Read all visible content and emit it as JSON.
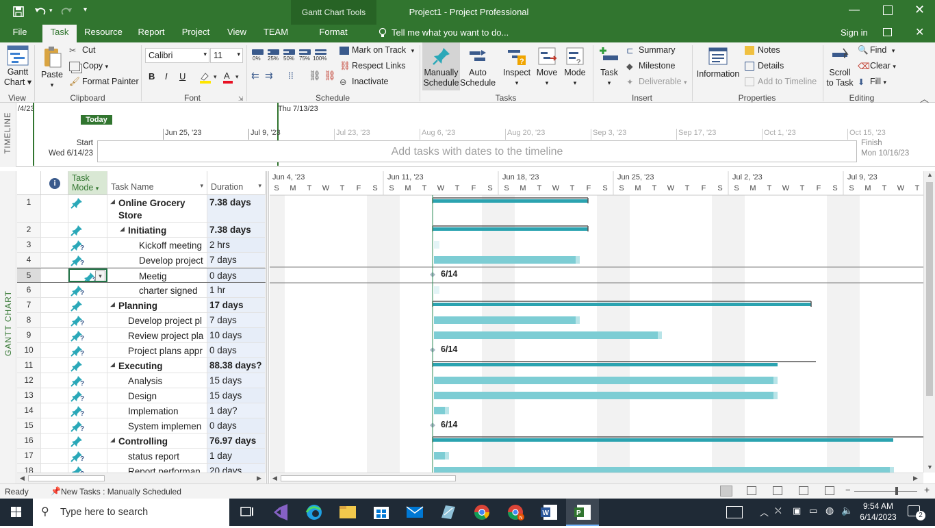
{
  "window": {
    "contextual_tab_group": "Gantt Chart Tools",
    "title": "Project1 - Project Professional",
    "qat_labels": [
      "save",
      "undo",
      "redo",
      "customize"
    ]
  },
  "tabs": {
    "file": "File",
    "task": "Task",
    "resource": "Resource",
    "report": "Report",
    "project": "Project",
    "view": "View",
    "team": "TEAM",
    "format": "Format",
    "tell_me": "Tell me what you want to do...",
    "sign_in": "Sign in"
  },
  "ribbon": {
    "view_group": {
      "gantt_line1": "Gantt",
      "gantt_line2": "Chart",
      "label": "View"
    },
    "clipboard": {
      "paste": "Paste",
      "cut": "Cut",
      "copy": "Copy",
      "format_painter": "Format Painter",
      "label": "Clipboard"
    },
    "font": {
      "font_name": "Calibri",
      "font_size": "11",
      "bold": "B",
      "italic": "I",
      "underline": "U",
      "label": "Font"
    },
    "schedule": {
      "pct": [
        "0%",
        "25%",
        "50%",
        "75%",
        "100%"
      ],
      "mark_on_track": "Mark on Track",
      "respect_links": "Respect Links",
      "inactivate": "Inactivate",
      "label": "Schedule"
    },
    "tasks": {
      "manually_line1": "Manually",
      "manually_line2": "Schedule",
      "auto_line1": "Auto",
      "auto_line2": "Schedule",
      "inspect": "Inspect",
      "move": "Move",
      "mode": "Mode",
      "label": "Tasks"
    },
    "insert": {
      "task": "Task",
      "summary": "Summary",
      "milestone": "Milestone",
      "deliverable": "Deliverable",
      "label": "Insert"
    },
    "properties": {
      "information": "Information",
      "notes": "Notes",
      "details": "Details",
      "add_to_timeline": "Add to Timeline",
      "label": "Properties"
    },
    "editing": {
      "scroll_line1": "Scroll",
      "scroll_line2": "to Task",
      "find": "Find",
      "clear": "Clear",
      "fill": "Fill",
      "label": "Editing"
    }
  },
  "timeline": {
    "side_label": "TIMELINE",
    "left_clip": "/4/23",
    "today": "Today",
    "current_date": "Thu 7/13/23",
    "start_label": "Start",
    "start_date": "Wed 6/14/23",
    "finish_label": "Finish",
    "finish_date": "Mon 10/16/23",
    "placeholder": "Add tasks with dates to the timeline",
    "ticks": [
      "Jun 25, '23",
      "Jul 9, '23",
      "Jul 23, '23",
      "Aug 6, '23",
      "Aug 20, '23",
      "Sep 3, '23",
      "Sep 17, '23",
      "Oct 1, '23",
      "Oct 15, '23"
    ]
  },
  "gantt_side_label": "GANTT CHART",
  "table": {
    "headers": {
      "mode_line1": "Task",
      "mode_line2": "Mode",
      "name": "Task Name",
      "duration": "Duration"
    },
    "rows": [
      {
        "id": "1",
        "name": "Online Grocery",
        "name2": "Store",
        "duration": "7.38 days",
        "summary": true,
        "level": 0
      },
      {
        "id": "2",
        "name": "Initiating",
        "duration": "7.38 days",
        "summary": true,
        "level": 1
      },
      {
        "id": "3",
        "name": "Kickoff meeting",
        "duration": "2 hrs",
        "summary": false,
        "level": 2
      },
      {
        "id": "4",
        "name": "Develop project",
        "duration": "7 days",
        "summary": false,
        "level": 2
      },
      {
        "id": "5",
        "name": "Meetig",
        "duration": "0 days",
        "summary": false,
        "level": 2
      },
      {
        "id": "6",
        "name": "charter signed",
        "duration": "1 hr",
        "summary": false,
        "level": 2
      },
      {
        "id": "7",
        "name": "Planning",
        "duration": "17 days",
        "summary": true,
        "level": 0
      },
      {
        "id": "8",
        "name": "Develop project pl",
        "duration": "7 days",
        "summary": false,
        "level": 1
      },
      {
        "id": "9",
        "name": "Review project pla",
        "duration": "10 days",
        "summary": false,
        "level": 1
      },
      {
        "id": "10",
        "name": "Project plans appr",
        "duration": "0 days",
        "summary": false,
        "level": 1
      },
      {
        "id": "11",
        "name": "Executing",
        "duration": "88.38 days?",
        "summary": true,
        "level": 0
      },
      {
        "id": "12",
        "name": "Analysis",
        "duration": "15 days",
        "summary": false,
        "level": 1
      },
      {
        "id": "13",
        "name": "Design",
        "duration": "15 days",
        "summary": false,
        "level": 1
      },
      {
        "id": "14",
        "name": "Implemation",
        "duration": "1 day?",
        "summary": false,
        "level": 1
      },
      {
        "id": "15",
        "name": "System implemen",
        "duration": "0 days",
        "summary": false,
        "level": 1
      },
      {
        "id": "16",
        "name": "Controlling",
        "duration": "76.97 days",
        "summary": true,
        "level": 0
      },
      {
        "id": "17",
        "name": "status report",
        "duration": "1 day",
        "summary": false,
        "level": 1
      },
      {
        "id": "18",
        "name": "Report performan",
        "duration": "20 days",
        "summary": false,
        "level": 1
      }
    ]
  },
  "chart": {
    "weeks": [
      "Jun 4, '23",
      "Jun 11, '23",
      "Jun 18, '23",
      "Jun 25, '23",
      "Jul 2, '23",
      "Jul 9, '23"
    ],
    "day_letters": [
      "S",
      "M",
      "T",
      "W",
      "T",
      "F",
      "S"
    ],
    "milestones": [
      "6/14",
      "6/14",
      "6/14"
    ]
  },
  "status": {
    "ready": "Ready",
    "new_tasks": "New Tasks : Manually Scheduled"
  },
  "taskbar": {
    "search_placeholder": "Type here to search",
    "time": "9:54 AM",
    "date": "6/14/2023",
    "notifications": "2"
  }
}
